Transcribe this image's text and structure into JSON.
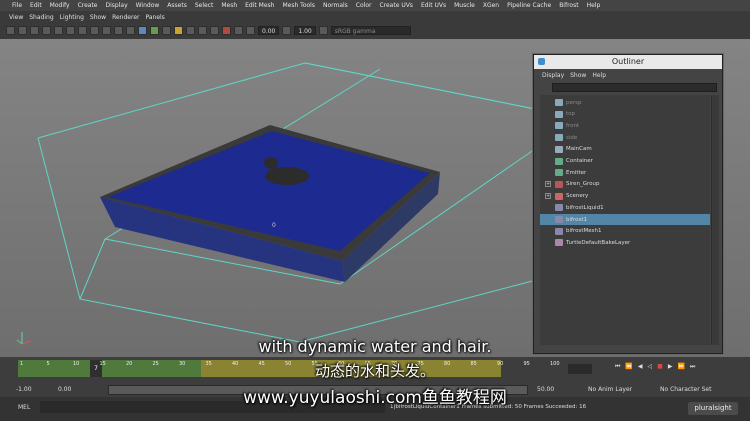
{
  "menubar": [
    "File",
    "Edit",
    "Modify",
    "Create",
    "Display",
    "Window",
    "Assets",
    "Select",
    "Mesh",
    "Edit Mesh",
    "Mesh Tools",
    "Normals",
    "Color",
    "Create UVs",
    "Edit UVs",
    "Muscle",
    "XGen",
    "Pipeline Cache",
    "Bifrost",
    "Help"
  ],
  "panel_menu": [
    "View",
    "Shading",
    "Lighting",
    "Show",
    "Renderer",
    "Panels"
  ],
  "toolbar": {
    "value1": "0.00",
    "value2": "1.00",
    "colorspace": "sRGB gamma"
  },
  "viewport": {
    "origin_label": "0"
  },
  "outliner": {
    "title": "Outliner",
    "menu": [
      "Display",
      "Show",
      "Help"
    ],
    "items": [
      {
        "label": "persp",
        "dim": true,
        "expand": ""
      },
      {
        "label": "top",
        "dim": true,
        "expand": ""
      },
      {
        "label": "front",
        "dim": true,
        "expand": ""
      },
      {
        "label": "side",
        "dim": true,
        "expand": ""
      },
      {
        "label": "MainCam",
        "dim": false,
        "expand": ""
      },
      {
        "label": "Container",
        "dim": false,
        "expand": ""
      },
      {
        "label": "Emitter",
        "dim": false,
        "expand": ""
      },
      {
        "label": "Siren_Group",
        "dim": false,
        "expand": "+"
      },
      {
        "label": "Scenery",
        "dim": false,
        "expand": "+"
      },
      {
        "label": "bifrostLiquid1",
        "dim": false,
        "expand": ""
      },
      {
        "label": "bifrost1",
        "dim": false,
        "expand": "",
        "selected": true
      },
      {
        "label": "bifrostMesh1",
        "dim": false,
        "expand": ""
      },
      {
        "label": "TurtleDefaultBakeLayer",
        "dim": false,
        "expand": ""
      }
    ]
  },
  "timeline": {
    "ticks": [
      "1",
      "5",
      "10",
      "15",
      "20",
      "25",
      "30",
      "35",
      "40",
      "45",
      "50",
      "55",
      "60",
      "65",
      "70",
      "75",
      "80",
      "85",
      "90",
      "95",
      "100"
    ],
    "current_frame": "7"
  },
  "range": {
    "start": "-1.00",
    "start2": "0.00",
    "end": "50.00",
    "anim_layer": "No Anim Layer",
    "character_set": "No Character Set"
  },
  "status": {
    "mel_label": "MEL",
    "message": "1|bifrostLiquidContainer1 Frames submitted: 50 Frames Succeeded: 16"
  },
  "subtitles": {
    "line1": "with dynamic water and hair.",
    "line2": "动态的水和头发。",
    "line3": "www.yuyulaoshi.com鱼鱼教程网"
  },
  "watermark": "pluralsight"
}
